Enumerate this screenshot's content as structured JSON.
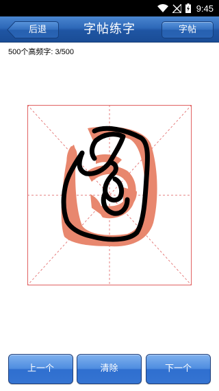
{
  "status_bar": {
    "time": "9:45"
  },
  "header": {
    "back_label": "后退",
    "title": "字帖练字",
    "copybook_label": "字帖"
  },
  "progress": {
    "text": "500个高频字: 3/500"
  },
  "footer": {
    "prev_label": "上一个",
    "clear_label": "清除",
    "next_label": "下一个"
  },
  "colors": {
    "header_blue": "#2d68b8",
    "guide_red": "#e06060",
    "character_fill": "#e8876e",
    "ink": "#000000"
  }
}
